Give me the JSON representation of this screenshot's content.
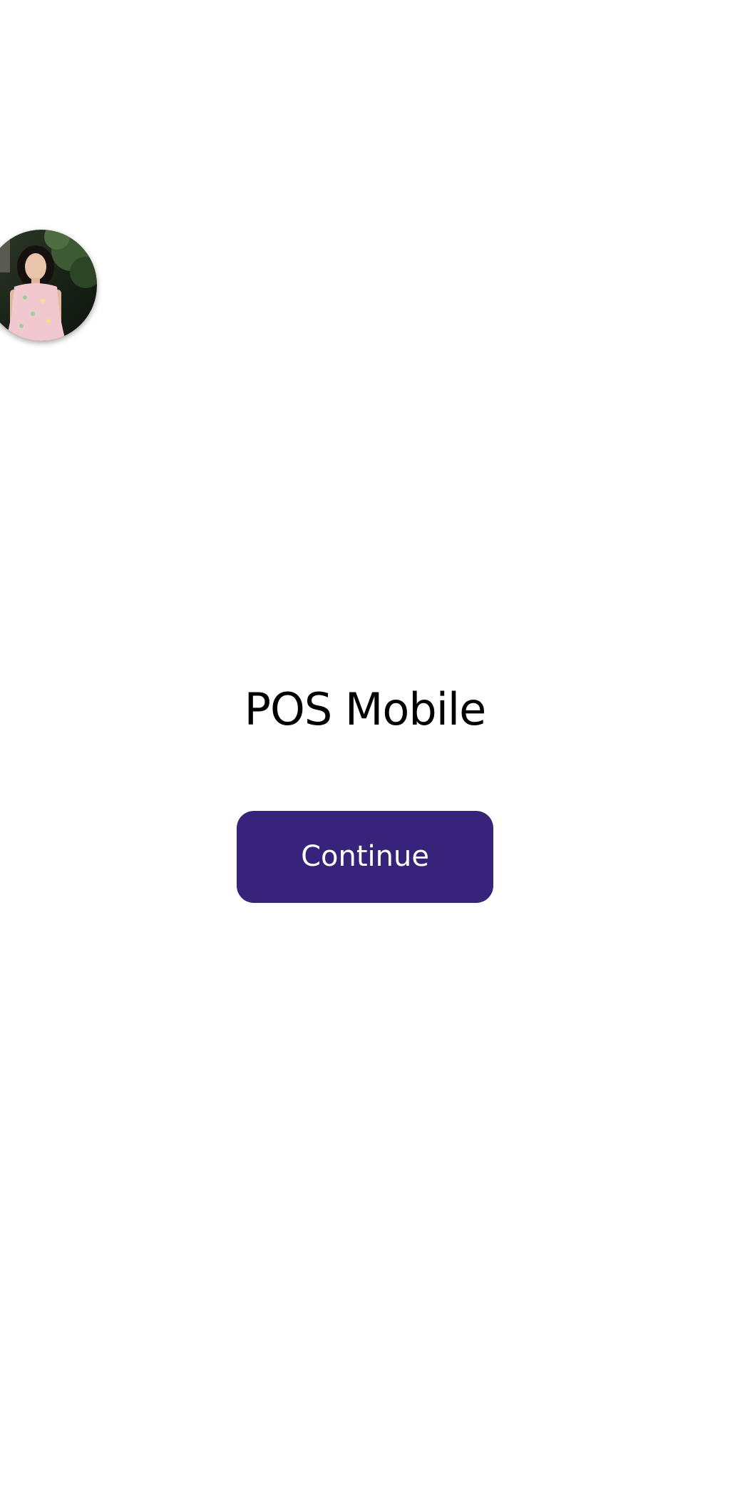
{
  "app": {
    "title": "POS Mobile"
  },
  "actions": {
    "continue_label": "Continue"
  },
  "floating_bubble": {
    "icon": "profile-photo-avatar"
  },
  "colors": {
    "background": "#ffffff",
    "primary_button": "#37237a",
    "button_text": "#ffffff",
    "title_text": "#000000"
  }
}
